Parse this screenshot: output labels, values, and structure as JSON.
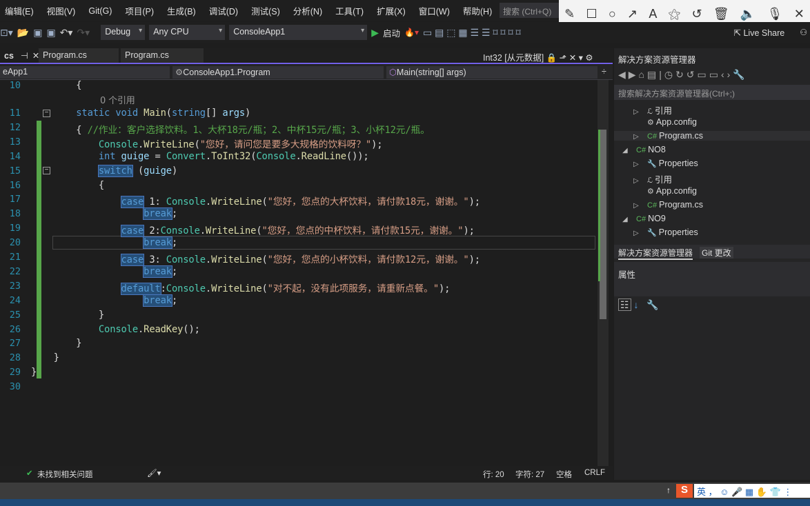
{
  "menu": [
    "编辑(E)",
    "视图(V)",
    "Git(G)",
    "项目(P)",
    "生成(B)",
    "调试(D)",
    "测试(S)",
    "分析(N)",
    "工具(T)",
    "扩展(X)",
    "窗口(W)",
    "帮助(H)"
  ],
  "search_placeholder": "搜索 (Ctrl+Q)",
  "annotation_tools": [
    "pencil-icon",
    "rectangle-icon",
    "circle-icon",
    "arrow-icon",
    "text-icon",
    "magic-wand-icon",
    "undo-icon",
    "trash-icon",
    "speaker-icon",
    "microphone-icon",
    "close-icon"
  ],
  "toolbar": {
    "config": "Debug",
    "platform": "Any CPU",
    "project": "ConsoleApp1",
    "start": "启动",
    "live_share": "Live Share"
  },
  "tabs": {
    "active": "cs",
    "tab2": "Program.cs",
    "tab3": "Program.cs",
    "preview": "Int32 [从元数据]"
  },
  "navbar": {
    "project": "eApp1",
    "class": "ConsoleApp1.Program",
    "member": "Main(string[] args)"
  },
  "codelens": "0 个引用",
  "code": [
    {
      "n": "10",
      "t": [
        [
          "",
          "        {"
        ]
      ]
    },
    {
      "n": "11",
      "t": [
        [
          "",
          "        "
        ],
        [
          "kw",
          "static void "
        ],
        [
          "me",
          "Main"
        ],
        [
          "",
          "("
        ],
        [
          "kw",
          "string"
        ],
        [
          "",
          "[] "
        ],
        [
          "va",
          "args"
        ],
        [
          "",
          ")"
        ]
      ]
    },
    {
      "n": "12",
      "t": [
        [
          "",
          "        { "
        ],
        [
          "cm",
          "//作业：客户选择饮料。1、大杯18元/瓶；2、中杯15元/瓶；3、小杯12元/瓶。"
        ]
      ]
    },
    {
      "n": "13",
      "t": [
        [
          "",
          "            "
        ],
        [
          "ty",
          "Console"
        ],
        [
          "",
          "."
        ],
        [
          "me",
          "WriteLine"
        ],
        [
          "",
          "("
        ],
        [
          "st",
          "\"您好，请问您是要多大规格的饮料呀？\""
        ],
        [
          "",
          ");"
        ]
      ]
    },
    {
      "n": "14",
      "t": [
        [
          "",
          "            "
        ],
        [
          "kw",
          "int "
        ],
        [
          "va",
          "guige"
        ],
        [
          "",
          " = "
        ],
        [
          "ty",
          "Convert"
        ],
        [
          "",
          "."
        ],
        [
          "me",
          "ToInt32"
        ],
        [
          "",
          "("
        ],
        [
          "ty",
          "Console"
        ],
        [
          "",
          "."
        ],
        [
          "me",
          "ReadLine"
        ],
        [
          "",
          "());"
        ]
      ]
    },
    {
      "n": "15",
      "t": [
        [
          "",
          "            "
        ],
        [
          "kw hl",
          "switch"
        ],
        [
          "",
          " ("
        ],
        [
          "va",
          "guige"
        ],
        [
          "",
          ")"
        ]
      ]
    },
    {
      "n": "16",
      "t": [
        [
          "",
          "            {"
        ]
      ]
    },
    {
      "n": "17",
      "t": [
        [
          "",
          "                "
        ],
        [
          "kw hl",
          "case"
        ],
        [
          "",
          " 1: "
        ],
        [
          "ty",
          "Console"
        ],
        [
          "",
          "."
        ],
        [
          "me",
          "WriteLine"
        ],
        [
          "",
          "("
        ],
        [
          "st",
          "\"您好，您点的大杯饮料，请付款18元，谢谢。\""
        ],
        [
          "",
          ");"
        ]
      ]
    },
    {
      "n": "18",
      "t": [
        [
          "",
          "                    "
        ],
        [
          "kw hl",
          "break"
        ],
        [
          "",
          ";"
        ]
      ]
    },
    {
      "n": "19",
      "t": [
        [
          "",
          "                "
        ],
        [
          "kw hl",
          "case"
        ],
        [
          "",
          " 2:"
        ],
        [
          "ty",
          "Console"
        ],
        [
          "",
          "."
        ],
        [
          "me",
          "WriteLine"
        ],
        [
          "",
          "("
        ],
        [
          "st",
          "\"您好，您点的中杯饮料，请付款15元，谢谢。\""
        ],
        [
          "",
          ");"
        ]
      ]
    },
    {
      "n": "20",
      "t": [
        [
          "",
          "                    "
        ],
        [
          "kw hl",
          "break"
        ],
        [
          "",
          ";"
        ]
      ]
    },
    {
      "n": "21",
      "t": [
        [
          "",
          "                "
        ],
        [
          "kw hl",
          "case"
        ],
        [
          "",
          " 3: "
        ],
        [
          "ty",
          "Console"
        ],
        [
          "",
          "."
        ],
        [
          "me",
          "WriteLine"
        ],
        [
          "",
          "("
        ],
        [
          "st",
          "\"您好，您点的小杯饮料，请付款12元，谢谢。\""
        ],
        [
          "",
          ");"
        ]
      ]
    },
    {
      "n": "22",
      "t": [
        [
          "",
          "                    "
        ],
        [
          "kw hl",
          "break"
        ],
        [
          "",
          ";"
        ]
      ]
    },
    {
      "n": "23",
      "t": [
        [
          "",
          "                "
        ],
        [
          "kw hl",
          "default"
        ],
        [
          "",
          ":"
        ],
        [
          "ty",
          "Console"
        ],
        [
          "",
          "."
        ],
        [
          "me",
          "WriteLine"
        ],
        [
          "",
          "("
        ],
        [
          "st",
          "\"对不起，没有此项服务，请重新点餐。\""
        ],
        [
          "",
          ");"
        ]
      ]
    },
    {
      "n": "24",
      "t": [
        [
          "",
          "                    "
        ],
        [
          "kw hl",
          "break"
        ],
        [
          "",
          ";"
        ]
      ]
    },
    {
      "n": "25",
      "t": [
        [
          "",
          "            }"
        ]
      ]
    },
    {
      "n": "26",
      "t": [
        [
          "",
          "            "
        ],
        [
          "ty",
          "Console"
        ],
        [
          "",
          "."
        ],
        [
          "me",
          "ReadKey"
        ],
        [
          "",
          "();"
        ]
      ]
    },
    {
      "n": "27",
      "t": [
        [
          "",
          "        }"
        ]
      ]
    },
    {
      "n": "28",
      "t": [
        [
          "",
          "    }"
        ]
      ]
    },
    {
      "n": "29",
      "t": [
        [
          "",
          "}"
        ]
      ]
    },
    {
      "n": "30",
      "t": []
    }
  ],
  "status": {
    "issues": "未找到相关问题",
    "line": "行: 20",
    "char": "字符: 27",
    "spaces": "空格",
    "eol": "CRLF"
  },
  "solution_explorer": {
    "title": "解决方案资源管理器",
    "search_placeholder": "搜索解决方案资源管理器(Ctrl+;)",
    "items": [
      {
        "label": "引用",
        "icon": "references-icon",
        "depth": 2,
        "exp": "▷"
      },
      {
        "label": "App.config",
        "icon": "config-icon",
        "depth": 2,
        "exp": ""
      },
      {
        "label": "Program.cs",
        "icon": "csharp-file-icon",
        "depth": 2,
        "exp": "▷"
      },
      {
        "label": "NO8",
        "icon": "csharp-project-icon",
        "depth": 1,
        "exp": "◢"
      },
      {
        "label": "Properties",
        "icon": "wrench-icon",
        "depth": 2,
        "exp": "▷"
      },
      {
        "label": "引用",
        "icon": "references-icon",
        "depth": 2,
        "exp": "▷"
      },
      {
        "label": "App.config",
        "icon": "config-icon",
        "depth": 2,
        "exp": ""
      },
      {
        "label": "Program.cs",
        "icon": "csharp-file-icon",
        "depth": 2,
        "exp": "▷"
      },
      {
        "label": "NO9",
        "icon": "csharp-project-icon",
        "depth": 1,
        "exp": "◢"
      },
      {
        "label": "Properties",
        "icon": "wrench-icon",
        "depth": 2,
        "exp": "▷"
      }
    ],
    "tab1": "解决方案资源管理器",
    "tab2": "Git 更改"
  },
  "properties": {
    "title": "属性"
  },
  "ime": {
    "lang": "英"
  }
}
